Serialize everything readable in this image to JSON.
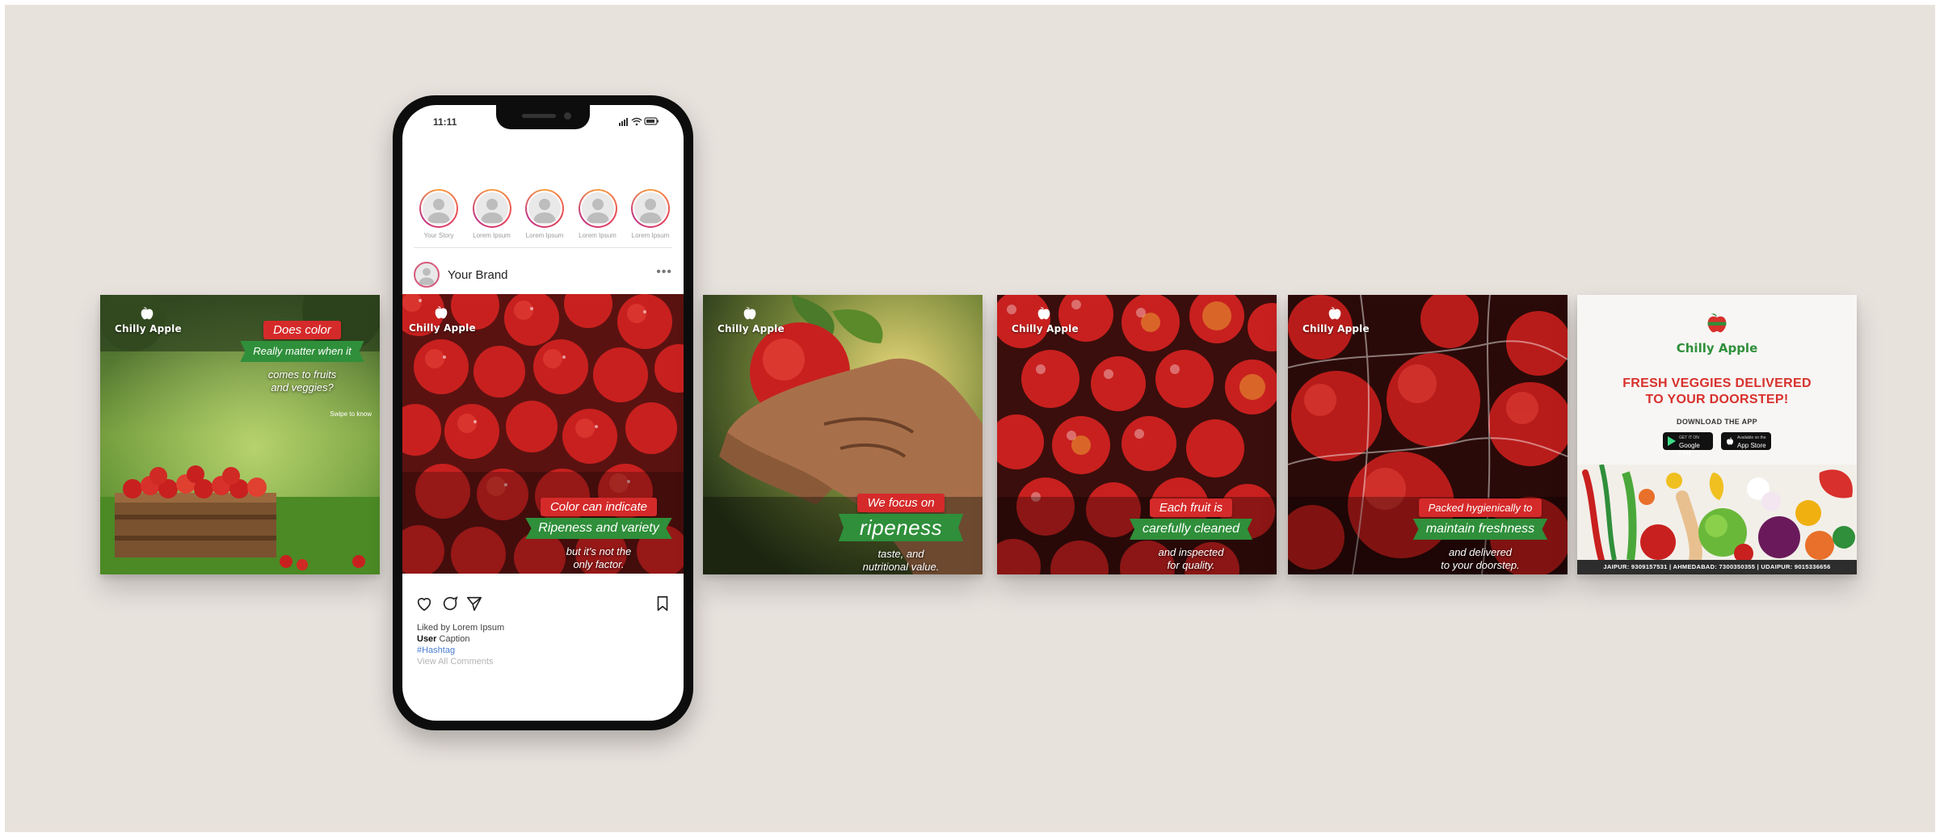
{
  "brand": {
    "name": "Chilly Apple"
  },
  "colors": {
    "accent_red": "#d52a2a",
    "accent_green": "#2f8f3a",
    "background": "#e8e2dd",
    "apple_red": "#c8201f"
  },
  "phone": {
    "status_time": "11:11",
    "stories": [
      {
        "label": "Your Story"
      },
      {
        "label": "Lorem Ipsum"
      },
      {
        "label": "Lorem Ipsum"
      },
      {
        "label": "Lorem Ipsum"
      },
      {
        "label": "Lorem Ipsum"
      }
    ],
    "post_account": "Your Brand",
    "more_icon": "ellipsis-icon",
    "post_caption": {
      "red": "Color can indicate",
      "green": "Ripeness and variety",
      "sub1": "but it's not the",
      "sub2": "only factor."
    },
    "liked_by": "Liked by Lorem Ipsum",
    "user": "User",
    "caption": "Caption",
    "hashtag": "#Hashtag",
    "view_comments": "View All Comments"
  },
  "cards": [
    {
      "red": "Does color",
      "green": "Really matter when it",
      "sub1": "comes to fruits",
      "sub2": "and veggies?",
      "swipe": "Swipe to know"
    },
    {
      "red": "We focus on",
      "green": "ripeness",
      "sub1": "taste, and",
      "sub2": "nutritional value."
    },
    {
      "red": "Each fruit is",
      "green": "carefully cleaned",
      "sub1": "and inspected",
      "sub2": "for quality."
    },
    {
      "red": "Packed hygienically to",
      "green": "maintain freshness",
      "sub1": "and delivered",
      "sub2": "to your doorstep."
    }
  ],
  "app_card": {
    "headline1": "FRESH VEGGIES DELIVERED",
    "headline2": "TO YOUR DOORSTEP!",
    "download": "DOWNLOAD THE APP",
    "google_small": "GET IT ON",
    "google": "Google Play",
    "apple_small": "Available on the",
    "apple": "App Store",
    "footer": "JAIPUR: 9309157531 | AHMEDABAD: 7300350355 | UDAIPUR: 9015336656"
  }
}
